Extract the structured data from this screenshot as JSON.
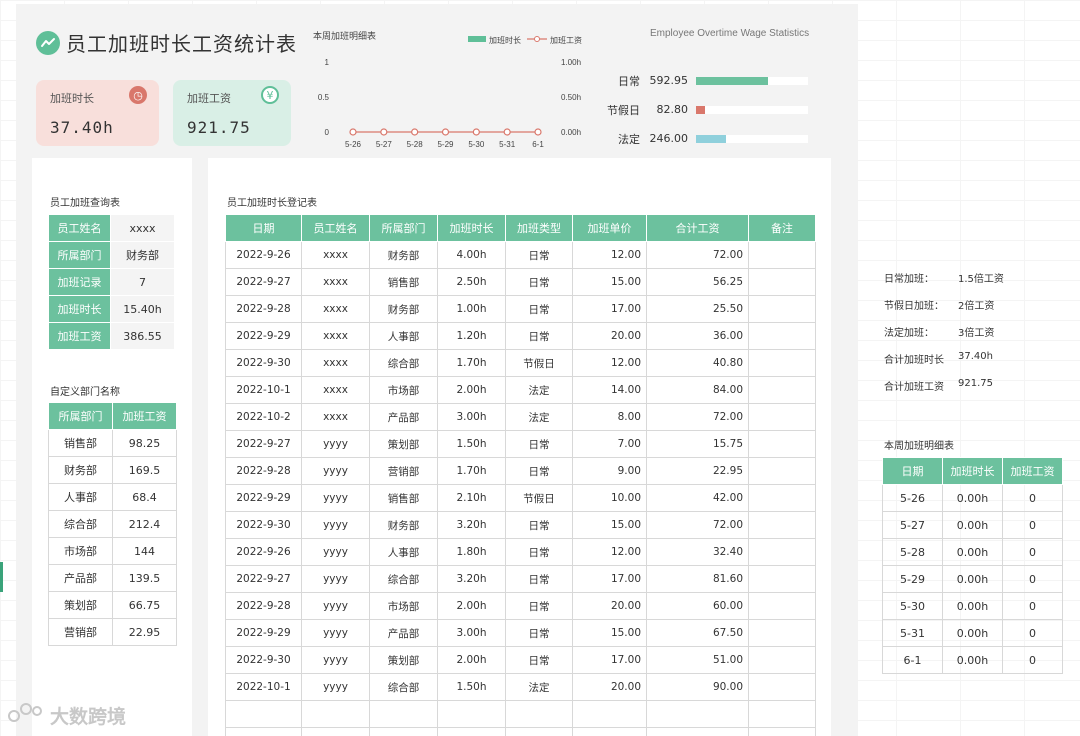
{
  "title": "员工加班时长工资统计表",
  "kpi": {
    "hours_label": "加班时长",
    "hours_value": "37.40h",
    "hours_icon": "clock-icon",
    "wage_label": "加班工资",
    "wage_value": "921.75",
    "wage_icon": "yen-icon"
  },
  "chart_data": {
    "type": "line",
    "title": "本周加班明细表",
    "categories": [
      "5-26",
      "5-27",
      "5-28",
      "5-29",
      "5-30",
      "5-31",
      "6-1"
    ],
    "series": [
      {
        "name": "加班时长",
        "type": "bar",
        "color": "#5fbf98",
        "axis": "right",
        "values": [
          0,
          0,
          0,
          0,
          0,
          0,
          0
        ]
      },
      {
        "name": "加班工资",
        "type": "line",
        "color": "#d9776b",
        "axis": "left",
        "values": [
          0,
          0,
          0,
          0,
          0,
          0,
          0
        ]
      }
    ],
    "yleft_ticks": [
      "1",
      "0.5",
      "0"
    ],
    "yright_ticks": [
      "1.00h",
      "0.50h",
      "0.00h"
    ],
    "ylim": [
      0,
      1
    ],
    "legend": "top-right"
  },
  "subtitle_en": "Employee Overtime Wage Statistics",
  "type_bars": [
    {
      "name": "日常",
      "value": "592.95",
      "fraction": 0.64,
      "color": "#6cc19e"
    },
    {
      "name": "节假日",
      "value": "82.80",
      "fraction": 0.08,
      "color": "#d9776b"
    },
    {
      "name": "法定",
      "value": "246.00",
      "fraction": 0.27,
      "color": "#8fd0dc"
    }
  ],
  "query": {
    "caption": "员工加班查询表",
    "rows": [
      {
        "label": "员工姓名",
        "value": "xxxx"
      },
      {
        "label": "所属部门",
        "value": "财务部"
      },
      {
        "label": "加班记录",
        "value": "7"
      },
      {
        "label": "加班时长",
        "value": "15.40h"
      },
      {
        "label": "加班工资",
        "value": "386.55"
      }
    ]
  },
  "dept": {
    "caption": "自定义部门名称",
    "headers": [
      "所属部门",
      "加班工资"
    ],
    "rows": [
      [
        "销售部",
        "98.25"
      ],
      [
        "财务部",
        "169.5"
      ],
      [
        "人事部",
        "68.4"
      ],
      [
        "综合部",
        "212.4"
      ],
      [
        "市场部",
        "144"
      ],
      [
        "产品部",
        "139.5"
      ],
      [
        "策划部",
        "66.75"
      ],
      [
        "营销部",
        "22.95"
      ]
    ]
  },
  "register": {
    "caption": "员工加班时长登记表",
    "headers": [
      "日期",
      "员工姓名",
      "所属部门",
      "加班时长",
      "加班类型",
      "加班单价",
      "合计工资",
      "备注"
    ],
    "rows": [
      [
        "2022-9-26",
        "xxxx",
        "财务部",
        "4.00h",
        "日常",
        "12.00",
        "72.00",
        ""
      ],
      [
        "2022-9-27",
        "xxxx",
        "销售部",
        "2.50h",
        "日常",
        "15.00",
        "56.25",
        ""
      ],
      [
        "2022-9-28",
        "xxxx",
        "财务部",
        "1.00h",
        "日常",
        "17.00",
        "25.50",
        ""
      ],
      [
        "2022-9-29",
        "xxxx",
        "人事部",
        "1.20h",
        "日常",
        "20.00",
        "36.00",
        ""
      ],
      [
        "2022-9-30",
        "xxxx",
        "综合部",
        "1.70h",
        "节假日",
        "12.00",
        "40.80",
        ""
      ],
      [
        "2022-10-1",
        "xxxx",
        "市场部",
        "2.00h",
        "法定",
        "14.00",
        "84.00",
        ""
      ],
      [
        "2022-10-2",
        "xxxx",
        "产品部",
        "3.00h",
        "法定",
        "8.00",
        "72.00",
        ""
      ],
      [
        "2022-9-27",
        "yyyy",
        "策划部",
        "1.50h",
        "日常",
        "7.00",
        "15.75",
        ""
      ],
      [
        "2022-9-28",
        "yyyy",
        "营销部",
        "1.70h",
        "日常",
        "9.00",
        "22.95",
        ""
      ],
      [
        "2022-9-29",
        "yyyy",
        "销售部",
        "2.10h",
        "节假日",
        "10.00",
        "42.00",
        ""
      ],
      [
        "2022-9-30",
        "yyyy",
        "财务部",
        "3.20h",
        "日常",
        "15.00",
        "72.00",
        ""
      ],
      [
        "2022-9-26",
        "yyyy",
        "人事部",
        "1.80h",
        "日常",
        "12.00",
        "32.40",
        ""
      ],
      [
        "2022-9-27",
        "yyyy",
        "综合部",
        "3.20h",
        "日常",
        "17.00",
        "81.60",
        ""
      ],
      [
        "2022-9-28",
        "yyyy",
        "市场部",
        "2.00h",
        "日常",
        "20.00",
        "60.00",
        ""
      ],
      [
        "2022-9-29",
        "yyyy",
        "产品部",
        "3.00h",
        "日常",
        "15.00",
        "67.50",
        ""
      ],
      [
        "2022-9-30",
        "yyyy",
        "策划部",
        "2.00h",
        "日常",
        "17.00",
        "51.00",
        ""
      ],
      [
        "2022-10-1",
        "yyyy",
        "综合部",
        "1.50h",
        "法定",
        "20.00",
        "90.00",
        ""
      ],
      [
        "",
        "",
        "",
        "",
        "",
        "",
        "",
        ""
      ],
      [
        "",
        "",
        "",
        "",
        "",
        "",
        "",
        ""
      ]
    ]
  },
  "notes": [
    {
      "k": "日常加班：",
      "v": "1.5倍工资"
    },
    {
      "k": "节假日加班：",
      "v": "2倍工资"
    },
    {
      "k": "法定加班：",
      "v": "3倍工资"
    },
    {
      "k": "合计加班时长",
      "v": "37.40h"
    },
    {
      "k": "合计加班工资",
      "v": "921.75"
    }
  ],
  "week": {
    "caption": "本周加班明细表",
    "headers": [
      "日期",
      "加班时长",
      "加班工资"
    ],
    "rows": [
      [
        "5-26",
        "0.00h",
        "0"
      ],
      [
        "5-27",
        "0.00h",
        "0"
      ],
      [
        "5-28",
        "0.00h",
        "0"
      ],
      [
        "5-29",
        "0.00h",
        "0"
      ],
      [
        "5-30",
        "0.00h",
        "0"
      ],
      [
        "5-31",
        "0.00h",
        "0"
      ],
      [
        "6-1",
        "0.00h",
        "0"
      ]
    ]
  },
  "watermark": "大数跨境"
}
